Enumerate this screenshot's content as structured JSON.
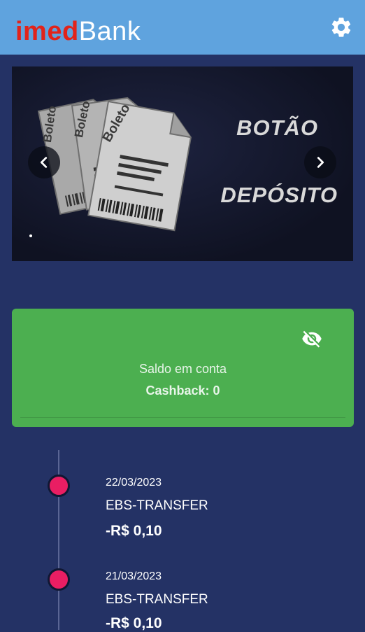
{
  "header": {
    "logo_part1": "imed",
    "logo_part2": "Bank",
    "settings_icon": "gear-icon"
  },
  "banner": {
    "line1": "BOTÃO",
    "line2": "DEPÓSITO",
    "ticket_label": "Boleto",
    "prev_icon": "chevron-left-icon",
    "next_icon": "chevron-right-icon"
  },
  "balance": {
    "label": "Saldo em conta",
    "cashback": "Cashback: 0",
    "visibility_icon": "eye-off-icon"
  },
  "transactions": [
    {
      "date": "22/03/2023",
      "description": "EBS-TRANSFER",
      "amount": "-R$ 0,10"
    },
    {
      "date": "21/03/2023",
      "description": "EBS-TRANSFER",
      "amount": "-R$ 0,10"
    }
  ],
  "colors": {
    "header": "#5fa3de",
    "background": "#243265",
    "card": "#4caf50",
    "logo_red": "#e2231a",
    "timeline_dot": "#e91e63"
  }
}
